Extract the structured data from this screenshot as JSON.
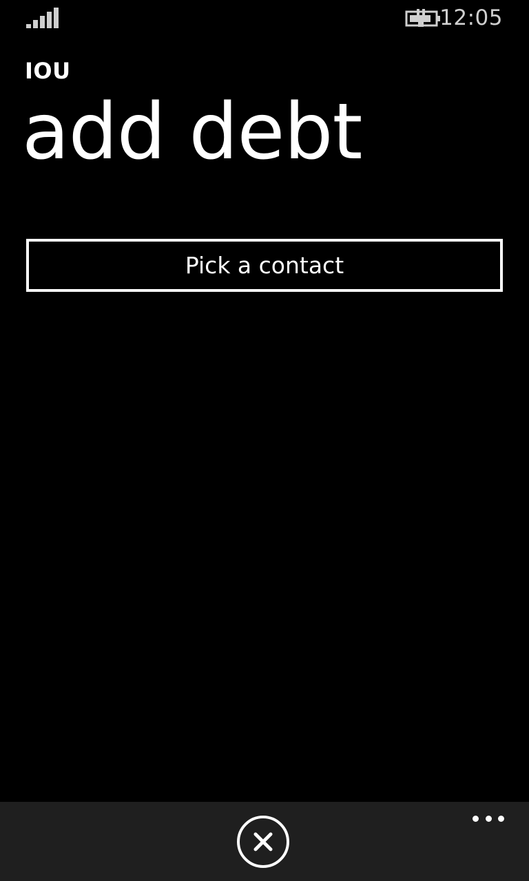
{
  "status_bar": {
    "signal_icon": "signal-strength-icon",
    "battery_icon": "battery-charging-icon",
    "time": "12:05"
  },
  "header": {
    "app_name": "IOU",
    "page_title": "add debt"
  },
  "main": {
    "pick_contact_label": "Pick a contact"
  },
  "app_bar": {
    "cancel_icon": "close-icon",
    "more_icon": "more-icon"
  },
  "colors": {
    "background": "#000000",
    "foreground": "#ffffff",
    "app_bar": "#1f1f1f",
    "status_text": "#cfcfcf"
  }
}
